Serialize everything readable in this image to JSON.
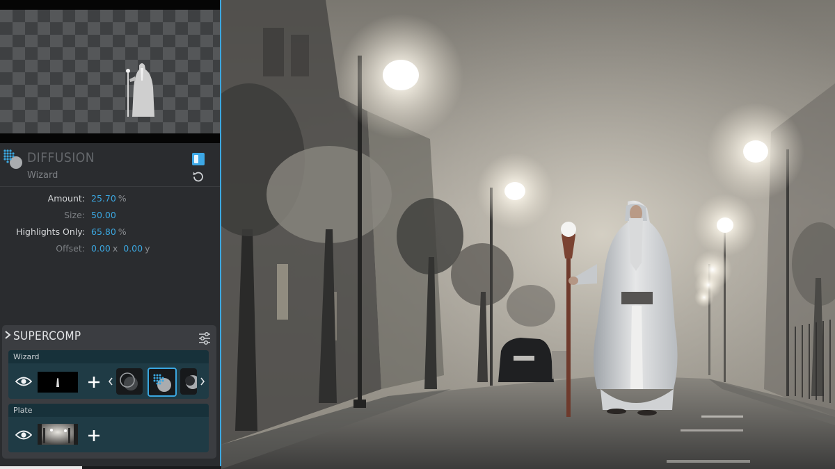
{
  "effect": {
    "name": "DIFFUSION",
    "layer": "Wizard",
    "params": [
      {
        "label": "Amount:",
        "value": "25.70",
        "unit": "%",
        "emphasis": true
      },
      {
        "label": "Size:",
        "value": "50.00",
        "unit": "",
        "emphasis": false
      },
      {
        "label": "Highlights Only:",
        "value": "65.80",
        "unit": "%",
        "emphasis": true
      },
      {
        "label": "Offset:",
        "value": "0.00",
        "unit": "x",
        "value2": "0.00",
        "unit2": "y",
        "emphasis": false
      }
    ]
  },
  "supercomp": {
    "title": "SUPERCOMP",
    "layers": [
      {
        "name": "Wizard"
      },
      {
        "name": "Plate"
      }
    ]
  },
  "colors": {
    "accent": "#3ba7e0",
    "panel": "#2a2c2f",
    "layer": "#1f3b45"
  }
}
